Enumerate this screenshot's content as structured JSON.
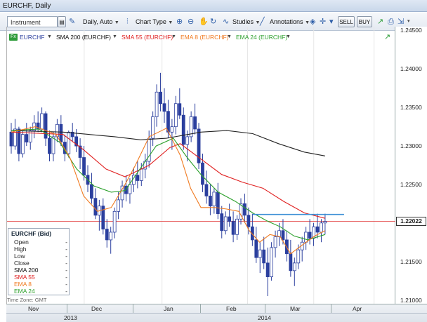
{
  "window": {
    "title": "EURCHF, Daily"
  },
  "toolbar": {
    "instrument_placeholder": "Instrument",
    "period": "Daily, Auto",
    "chart_type": "Chart Type",
    "studies": "Studies",
    "annotations": "Annotations",
    "sell": "SELL",
    "buy": "BUY"
  },
  "legend": {
    "fx_badge": "Fx",
    "symbol": "EURCHF",
    "sma200": "SMA 200 (EURCHF)",
    "sma55": "SMA 55 (EURCHF)",
    "ema8": "EMA 8 (EURCHF)",
    "ema24": "EMA 24 (EURCHF)"
  },
  "colors": {
    "candle": "#2b3f9e",
    "sma200": "#222222",
    "sma55": "#e02020",
    "ema8": "#f07a20",
    "ema24": "#2ca02c",
    "hline": "#3b8fd6",
    "price_line": "#e03030"
  },
  "data_window": {
    "title": "EURCHF (Bid)",
    "rows": [
      {
        "label": "Open",
        "value": "-"
      },
      {
        "label": "High",
        "value": "-"
      },
      {
        "label": "Low",
        "value": "-"
      },
      {
        "label": "Close",
        "value": "-"
      },
      {
        "label": "SMA 200",
        "value": "-",
        "color": "#111111"
      },
      {
        "label": "SMA 55",
        "value": "-",
        "color": "#e02020"
      },
      {
        "label": "EMA 8",
        "value": "-",
        "color": "#f07a20"
      },
      {
        "label": "EMA 24",
        "value": "-",
        "color": "#2ca02c"
      }
    ]
  },
  "time_zone": "Time Zone: GMT",
  "current_price": "1.22022",
  "chart_data": {
    "type": "candlestick",
    "ylim": [
      1.2095,
      1.2455
    ],
    "y_ticks": [
      "1.24500",
      "1.24000",
      "1.23500",
      "1.23000",
      "1.22500",
      "1.21500",
      "1.21000"
    ],
    "x_months": [
      "Nov",
      "Dec",
      "Jan",
      "Feb",
      "Mar",
      "Apr"
    ],
    "x_years": [
      "2013",
      "2014"
    ],
    "sma200": [
      [
        0,
        1.232
      ],
      [
        30,
        1.2318
      ],
      [
        60,
        1.2312
      ],
      [
        75,
        1.2308
      ],
      [
        90,
        1.231
      ],
      [
        110,
        1.2318
      ],
      [
        125,
        1.232
      ],
      [
        140,
        1.2316
      ],
      [
        155,
        1.2303
      ],
      [
        170,
        1.2292
      ],
      [
        182,
        1.2287
      ]
    ],
    "sma55": [
      [
        0,
        1.2318
      ],
      [
        30,
        1.2315
      ],
      [
        42,
        1.2295
      ],
      [
        55,
        1.227
      ],
      [
        66,
        1.226
      ],
      [
        80,
        1.2275
      ],
      [
        92,
        1.2298
      ],
      [
        98,
        1.2303
      ],
      [
        110,
        1.2283
      ],
      [
        122,
        1.2263
      ],
      [
        134,
        1.2253
      ],
      [
        146,
        1.2245
      ],
      [
        158,
        1.2228
      ],
      [
        170,
        1.2213
      ],
      [
        182,
        1.2206
      ]
    ],
    "ema8": [
      [
        0,
        1.2318
      ],
      [
        14,
        1.2325
      ],
      [
        26,
        1.2315
      ],
      [
        34,
        1.2285
      ],
      [
        42,
        1.2235
      ],
      [
        50,
        1.2215
      ],
      [
        58,
        1.222
      ],
      [
        66,
        1.225
      ],
      [
        72,
        1.2275
      ],
      [
        80,
        1.2312
      ],
      [
        90,
        1.2323
      ],
      [
        98,
        1.2288
      ],
      [
        104,
        1.2245
      ],
      [
        110,
        1.222
      ],
      [
        118,
        1.222
      ],
      [
        125,
        1.2218
      ],
      [
        132,
        1.2215
      ],
      [
        138,
        1.219
      ],
      [
        144,
        1.2175
      ],
      [
        150,
        1.2185
      ],
      [
        156,
        1.2182
      ],
      [
        162,
        1.216
      ],
      [
        168,
        1.217
      ],
      [
        176,
        1.2183
      ],
      [
        182,
        1.219
      ]
    ],
    "ema24": [
      [
        0,
        1.232
      ],
      [
        16,
        1.2322
      ],
      [
        28,
        1.2305
      ],
      [
        38,
        1.227
      ],
      [
        48,
        1.2248
      ],
      [
        58,
        1.224
      ],
      [
        66,
        1.2242
      ],
      [
        74,
        1.2268
      ],
      [
        84,
        1.23
      ],
      [
        94,
        1.231
      ],
      [
        102,
        1.2285
      ],
      [
        110,
        1.2263
      ],
      [
        120,
        1.224
      ],
      [
        130,
        1.2228
      ],
      [
        140,
        1.2213
      ],
      [
        148,
        1.2203
      ],
      [
        156,
        1.2195
      ],
      [
        164,
        1.2183
      ],
      [
        172,
        1.2178
      ],
      [
        182,
        1.2185
      ]
    ],
    "resistance": 1.2211,
    "candles": [
      [
        1.2318,
        1.233,
        1.229,
        1.23
      ],
      [
        1.23,
        1.2335,
        1.2295,
        1.2322
      ],
      [
        1.2322,
        1.2325,
        1.228,
        1.229
      ],
      [
        1.229,
        1.232,
        1.2285,
        1.2315
      ],
      [
        1.2315,
        1.233,
        1.23,
        1.2305
      ],
      [
        1.2305,
        1.2325,
        1.2295,
        1.232
      ],
      [
        1.232,
        1.234,
        1.231,
        1.233
      ],
      [
        1.233,
        1.2345,
        1.2318,
        1.2322
      ],
      [
        1.2322,
        1.235,
        1.2318,
        1.2342
      ],
      [
        1.2342,
        1.2345,
        1.23,
        1.231
      ],
      [
        1.231,
        1.232,
        1.228,
        1.229
      ],
      [
        1.229,
        1.2318,
        1.228,
        1.2312
      ],
      [
        1.2312,
        1.2335,
        1.2305,
        1.2328
      ],
      [
        1.2328,
        1.234,
        1.23,
        1.2305
      ],
      [
        1.2305,
        1.2315,
        1.228,
        1.229
      ],
      [
        1.229,
        1.232,
        1.2285,
        1.2318
      ],
      [
        1.2318,
        1.233,
        1.2305,
        1.2312
      ],
      [
        1.2312,
        1.2322,
        1.2292,
        1.23
      ],
      [
        1.23,
        1.231,
        1.227,
        1.2285
      ],
      [
        1.2285,
        1.23,
        1.2255,
        1.2262
      ],
      [
        1.2262,
        1.2275,
        1.224,
        1.225
      ],
      [
        1.225,
        1.2265,
        1.2225,
        1.2232
      ],
      [
        1.2232,
        1.2245,
        1.2205,
        1.221
      ],
      [
        1.221,
        1.223,
        1.219,
        1.2222
      ],
      [
        1.2222,
        1.2232,
        1.2185,
        1.2192
      ],
      [
        1.2192,
        1.2205,
        1.2168,
        1.2178
      ],
      [
        1.2178,
        1.2195,
        1.216,
        1.2188
      ],
      [
        1.2188,
        1.222,
        1.218,
        1.2215
      ],
      [
        1.2215,
        1.224,
        1.2205,
        1.223
      ],
      [
        1.223,
        1.2255,
        1.222,
        1.2248
      ],
      [
        1.2248,
        1.2262,
        1.2228,
        1.2238
      ],
      [
        1.2238,
        1.2258,
        1.2225,
        1.225
      ],
      [
        1.225,
        1.2272,
        1.224,
        1.2262
      ],
      [
        1.2262,
        1.228,
        1.2245,
        1.2255
      ],
      [
        1.2255,
        1.2278,
        1.2248,
        1.227
      ],
      [
        1.227,
        1.229,
        1.2258,
        1.228
      ],
      [
        1.228,
        1.232,
        1.2272,
        1.231
      ],
      [
        1.231,
        1.2345,
        1.23,
        1.2338
      ],
      [
        1.2338,
        1.238,
        1.2325,
        1.237
      ],
      [
        1.237,
        1.2395,
        1.2345,
        1.2355
      ],
      [
        1.2355,
        1.2375,
        1.233,
        1.2345
      ],
      [
        1.2345,
        1.236,
        1.231,
        1.2318
      ],
      [
        1.2318,
        1.2335,
        1.2295,
        1.2325
      ],
      [
        1.2325,
        1.2365,
        1.2315,
        1.2355
      ],
      [
        1.2355,
        1.2375,
        1.2335,
        1.234
      ],
      [
        1.234,
        1.235,
        1.2295,
        1.2302
      ],
      [
        1.2302,
        1.232,
        1.228,
        1.2312
      ],
      [
        1.2312,
        1.2345,
        1.2305,
        1.2338
      ],
      [
        1.2338,
        1.2355,
        1.2315,
        1.2322
      ],
      [
        1.2322,
        1.233,
        1.227,
        1.2278
      ],
      [
        1.2278,
        1.229,
        1.224,
        1.225
      ],
      [
        1.225,
        1.2268,
        1.2225,
        1.2235
      ],
      [
        1.2235,
        1.225,
        1.221,
        1.2222
      ],
      [
        1.2222,
        1.2245,
        1.2212,
        1.224
      ],
      [
        1.224,
        1.2252,
        1.2205,
        1.2212
      ],
      [
        1.2212,
        1.2222,
        1.218,
        1.219
      ],
      [
        1.219,
        1.2215,
        1.2185,
        1.2208
      ],
      [
        1.2208,
        1.2225,
        1.2195,
        1.2202
      ],
      [
        1.2202,
        1.2215,
        1.2175,
        1.2185
      ],
      [
        1.2185,
        1.221,
        1.2178,
        1.2205
      ],
      [
        1.2205,
        1.2232,
        1.2198,
        1.2225
      ],
      [
        1.2225,
        1.2238,
        1.22,
        1.221
      ],
      [
        1.221,
        1.222,
        1.2185,
        1.2195
      ],
      [
        1.2195,
        1.2212,
        1.217,
        1.2178
      ],
      [
        1.2178,
        1.2195,
        1.2148,
        1.2155
      ],
      [
        1.2155,
        1.2175,
        1.2135,
        1.2165
      ],
      [
        1.2165,
        1.2182,
        1.214,
        1.2148
      ],
      [
        1.2148,
        1.2168,
        1.2105,
        1.213
      ],
      [
        1.213,
        1.2175,
        1.2125,
        1.2168
      ],
      [
        1.2168,
        1.219,
        1.2155,
        1.2182
      ],
      [
        1.2182,
        1.22,
        1.217,
        1.219
      ],
      [
        1.219,
        1.2205,
        1.2172,
        1.2178
      ],
      [
        1.2178,
        1.219,
        1.215,
        1.216
      ],
      [
        1.216,
        1.2178,
        1.213,
        1.2138
      ],
      [
        1.2138,
        1.2155,
        1.2118,
        1.2148
      ],
      [
        1.2148,
        1.2172,
        1.214,
        1.2165
      ],
      [
        1.2165,
        1.2182,
        1.215,
        1.2175
      ],
      [
        1.2175,
        1.2195,
        1.2165,
        1.2188
      ],
      [
        1.2188,
        1.2205,
        1.2172,
        1.218
      ],
      [
        1.218,
        1.22,
        1.217,
        1.2195
      ],
      [
        1.2195,
        1.2212,
        1.218,
        1.2188
      ],
      [
        1.2188,
        1.2205,
        1.2175,
        1.22
      ],
      [
        1.22,
        1.2212,
        1.2185,
        1.2202
      ]
    ]
  }
}
